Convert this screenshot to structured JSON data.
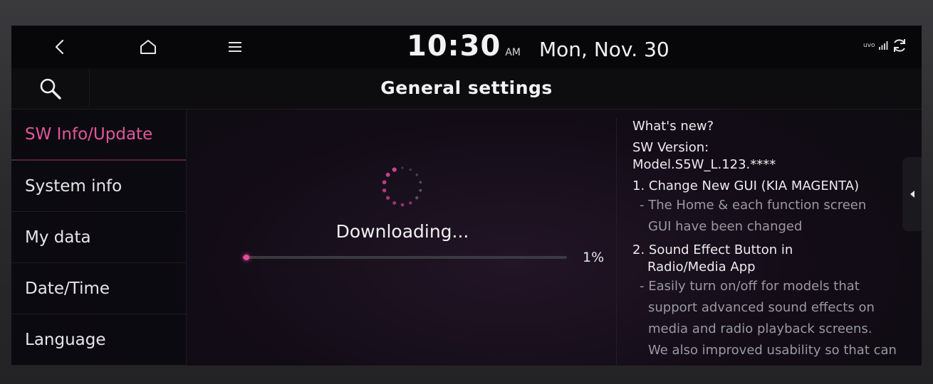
{
  "statusbar": {
    "time": "10:30",
    "ampm": "AM",
    "date": "Mon, Nov. 30",
    "uvo_label": "uvo",
    "icons": [
      "back-icon",
      "home-icon",
      "menu-icon",
      "signal-icon",
      "sync-icon"
    ]
  },
  "header": {
    "title": "General settings",
    "search_icon": "search-icon"
  },
  "sidebar": {
    "items": [
      {
        "label": "SW Info/Update",
        "active": true
      },
      {
        "label": "System info",
        "active": false
      },
      {
        "label": "My data",
        "active": false
      },
      {
        "label": "Date/Time",
        "active": false
      },
      {
        "label": "Language",
        "active": false
      }
    ]
  },
  "download": {
    "status": "Downloading...",
    "percent_label": "1%",
    "progress": 0.01
  },
  "info": {
    "heading": "What's new?",
    "version_label": "SW Version:",
    "version_value": "Model.S5W_L.123.****",
    "item1_title": "1. Change New GUI (KIA MAGENTA)",
    "item1_line1": "- The Home & each function screen",
    "item1_line2": "GUI have been changed",
    "item2_title": "2. Sound Effect Button in",
    "item2_title_cont": "Radio/Media App",
    "item2_line1": "- Easily turn on/off for models that",
    "item2_line2": "support advanced sound effects on",
    "item2_line3": "media and radio playback screens.",
    "item2_line4": "We also improved usability so that can"
  },
  "colors": {
    "accent": "#e0589a",
    "progress": "#d8368a",
    "background": "#0b0b0e"
  }
}
